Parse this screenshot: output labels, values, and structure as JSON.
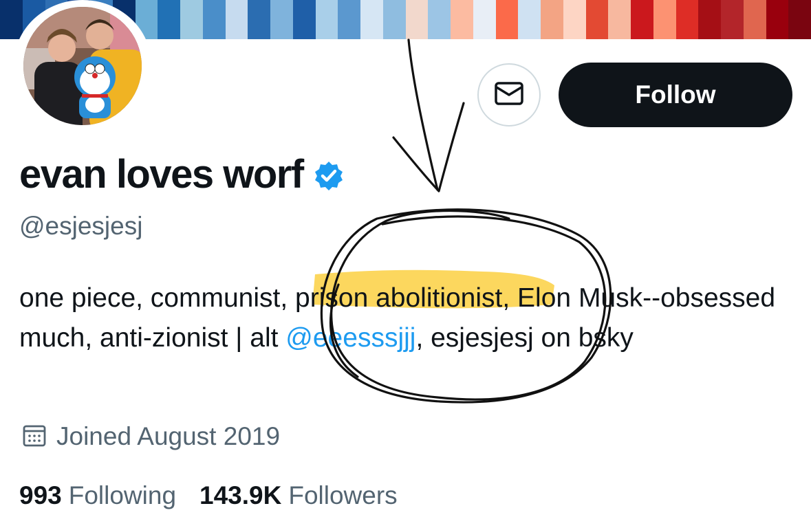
{
  "banner": {
    "stripe_colors": [
      "#08306b",
      "#1a5aa3",
      "#2f6fb3",
      "#1d4f9a",
      "#3a7fc0",
      "#08306b",
      "#6baed6",
      "#2171b5",
      "#9ecae1",
      "#4a8ec9",
      "#c6dbef",
      "#2b6db1",
      "#7fb3dc",
      "#1f5fa8",
      "#a9cfe9",
      "#5b98cf",
      "#d6e6f4",
      "#8fbde0",
      "#f2d8cc",
      "#9cc5e5",
      "#fcbba1",
      "#e8eef6",
      "#fb6a4a",
      "#cfe1f2",
      "#f3a484",
      "#fdd5c4",
      "#e34a33",
      "#f7b89f",
      "#cb181d",
      "#fc9272",
      "#de2d26",
      "#a50f15",
      "#b3252a",
      "#e0664f",
      "#99000d",
      "#7a0510"
    ]
  },
  "profile": {
    "display_name": "evan loves worf",
    "handle": "@esjesjesj",
    "bio": {
      "part1": "one piece, communist",
      "part2": ", ",
      "highlighted": "prison abolitionist",
      "part3": ", Elon Musk--obsessed much, anti-zionist | alt ",
      "mention": "@eeesssjjj",
      "part4": ", esjesjesj on bsky"
    },
    "joined": "Joined August 2019",
    "following_count": "993",
    "following_label": "Following",
    "followers_count": "143.9K",
    "followers_label": "Followers"
  },
  "actions": {
    "follow_label": "Follow"
  },
  "icons": {
    "message": "envelope-icon",
    "verified": "verified-badge-icon",
    "calendar": "calendar-icon"
  },
  "colors": {
    "accent": "#1d9bf0",
    "highlight": "#fcd34d",
    "secondary_text": "#536471",
    "primary_text": "#0f1419"
  }
}
